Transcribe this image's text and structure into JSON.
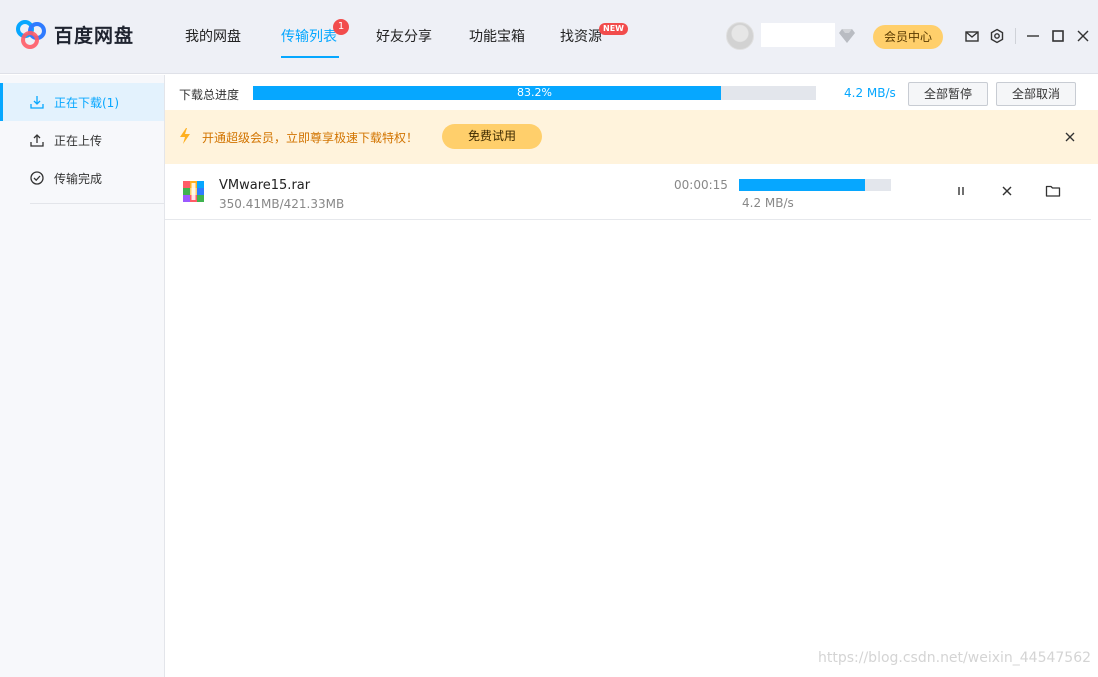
{
  "header": {
    "app_name": "百度网盘",
    "tabs": [
      {
        "label": "我的网盘"
      },
      {
        "label": "传输列表",
        "badge": "1",
        "active": true
      },
      {
        "label": "好友分享"
      },
      {
        "label": "功能宝箱"
      },
      {
        "label": "找资源",
        "badge": "NEW"
      }
    ],
    "vip_button": "会员中心",
    "icons": [
      "mail-icon",
      "settings-icon",
      "minimize-icon",
      "maximize-icon",
      "close-icon"
    ],
    "accent_color": "#06a7ff"
  },
  "sidebar": {
    "items": [
      {
        "label": "正在下载(1)",
        "icon": "download-icon",
        "active": true
      },
      {
        "label": "正在上传",
        "icon": "upload-icon"
      },
      {
        "label": "传输完成",
        "icon": "check-circle-icon"
      }
    ]
  },
  "total_progress": {
    "label": "下载总进度",
    "percent_text": "83.2%",
    "fraction": 0.832,
    "speed": "4.2 MB/s",
    "pause_all": "全部暂停",
    "cancel_all": "全部取消"
  },
  "banner": {
    "text": "开通超级会员，立即尊享极速下载特权！",
    "trial_button": "免费试用"
  },
  "downloads": [
    {
      "name": "VMware15.rar",
      "size": "350.41MB/421.33MB",
      "time_left": "00:00:15",
      "speed": "4.2 MB/s",
      "fraction": 0.832
    }
  ],
  "watermark": "https://blog.csdn.net/weixin_44547562"
}
